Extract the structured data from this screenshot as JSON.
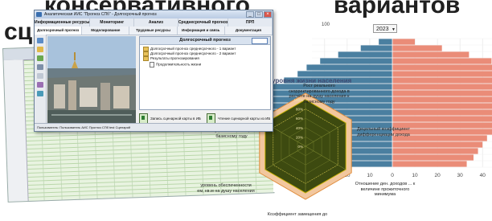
{
  "headline": {
    "line1_left": "консервативного",
    "line1_right": "вариантов",
    "line2_left": "сц"
  },
  "window": {
    "title": "Prognoz AHIS \"Prognoz SPB\" - Dolgosrochny prognoz",
    "title_display": "Аналитическая ИИС \"Прогноз СПб\" - Долгосрочный прогноз",
    "menu_main": [
      "Информационные ресурсы",
      "Мониторинг",
      "Анализ",
      "Среднесрочный прогноз",
      "ПРП"
    ],
    "menu_sub": [
      "Долгосрочный прогноз",
      "Моделирование",
      "Трудовые ресурсы",
      "Информация и связь",
      "Документация"
    ],
    "panel_title": "Долгосрочный прогноз",
    "tree_items": [
      "Долгосрочный прогноз среднесрочного - 1 вариант",
      "Долгосрочный прогноз среднесрочного - 2 вариант",
      "Результаты прогнозирования",
      "Продолжительность жизни"
    ],
    "card_left": "Запись сценарной карты в ИБ",
    "card_right": "Чтение сценарной карты из ИБ",
    "status": "Пользователь: Пользователь АИС Прогноз СПб   test   Сценарий"
  },
  "radar": {
    "title": "уровня жизни населения",
    "labels": {
      "top": "Рост реального скорректированного дохода в расчёте на душу населения к базисному году",
      "upper_left": "заработной платы, к базисному году",
      "lower_left": "уровень обеспеченности ем, кв.м на душу населения",
      "bottom": "Коэффициент замещения до",
      "upper_right": "Децильный коэффициент дифференциации дохода",
      "lower_right": "Отношение ден. доходов ... к величине прожиточного минимума"
    },
    "ticks": [
      "100%",
      "80%",
      "60%",
      "40%",
      "20%",
      "0%"
    ],
    "colors": {
      "scenario_fill": "#3d4a10",
      "scenario_edge": "#c8b400",
      "base_fill": "#f2c79e",
      "base_edge": "#e08c3c"
    }
  },
  "pyramid": {
    "year": "2023",
    "top_label": "100",
    "axis_ticks": [
      "30",
      "20",
      "10",
      "0",
      "10",
      "20",
      "30",
      "40",
      "50",
      "60",
      "70",
      "80"
    ],
    "colors": {
      "male": "#4a7fa0",
      "female": "#ea8c78"
    }
  },
  "chart_data": {
    "type": "bar",
    "title": "",
    "xlabel": "",
    "ylabel": "",
    "orientation": "horizontal",
    "series": [
      {
        "name": "",
        "values": [
          35,
          38,
          40,
          42,
          44,
          47,
          52,
          56,
          60,
          62,
          64,
          60,
          54,
          48,
          42,
          38,
          32,
          24,
          14,
          6
        ]
      },
      {
        "name": "",
        "values": [
          33,
          36,
          38,
          40,
          42,
          46,
          52,
          58,
          66,
          70,
          74,
          72,
          68,
          62,
          58,
          52,
          44,
          34,
          22,
          10
        ]
      }
    ],
    "grid": true
  }
}
